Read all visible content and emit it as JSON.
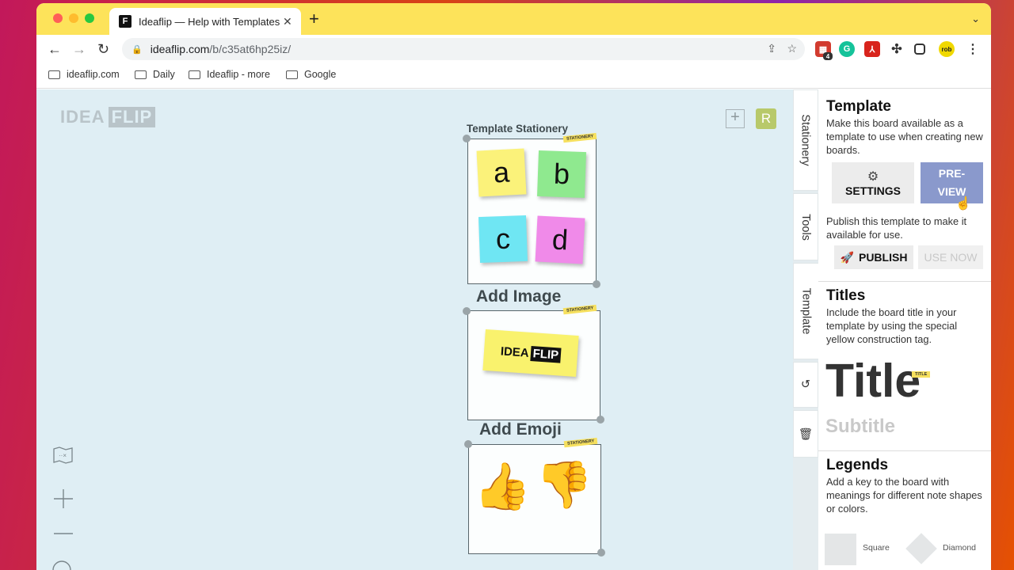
{
  "browser": {
    "tab_title": "Ideaflip — Help with Templates",
    "favicon_letter": "F",
    "close_glyph": "✕",
    "new_tab_glyph": "+",
    "url_host": "ideaflip.com",
    "url_path": "/b/c35at6hp25iz/",
    "extension_badge": "4",
    "bookmarks": [
      "ideaflip.com",
      "Daily",
      "Ideaflip - more",
      "Google"
    ]
  },
  "canvas": {
    "logo_idea": "IDEA",
    "logo_flip": "FLIP",
    "avatar_letter": "R",
    "cards": [
      {
        "title": "Template Stationery",
        "tag": "STATIONERY",
        "notes": [
          "a",
          "b",
          "c",
          "d"
        ],
        "note_colors": [
          "#fbf27a",
          "#8fe98f",
          "#6fe6f3",
          "#f08ae9"
        ]
      },
      {
        "title": "Add Image",
        "tag": "STATIONERY",
        "image_text_a": "IDEA",
        "image_text_b": "FLIP"
      },
      {
        "title": "Add Emoji",
        "tag": "STATIONERY",
        "emojis": [
          "👍",
          "👎"
        ]
      }
    ]
  },
  "side_tabs": [
    "Stationery",
    "Tools",
    "Template"
  ],
  "panel": {
    "template_title": "Template",
    "template_desc": "Make this board available as a template to use when creating new boards.",
    "settings_label": "SETTINGS",
    "preview_label": "PRE-\nVIEW",
    "publish_desc": "Publish this template to make it available for use.",
    "publish_label": "PUBLISH",
    "use_now_label": "USE NOW",
    "titles_title": "Titles",
    "titles_desc": "Include the board title in your template by using the special yellow construction tag.",
    "sample_title": "Title",
    "sample_title_tag": "TITLE",
    "sample_subtitle": "Subtitle",
    "legends_title": "Legends",
    "legends_desc": "Add a key to the board with meanings for different note shapes or colors.",
    "legend_square": "Square",
    "legend_diamond": "Diamond"
  },
  "colors": {
    "tabstrip": "#fde35a",
    "canvas_bg": "#dfeef4",
    "preview_btn": "#8a99cc",
    "settings_btn": "#ececec"
  }
}
